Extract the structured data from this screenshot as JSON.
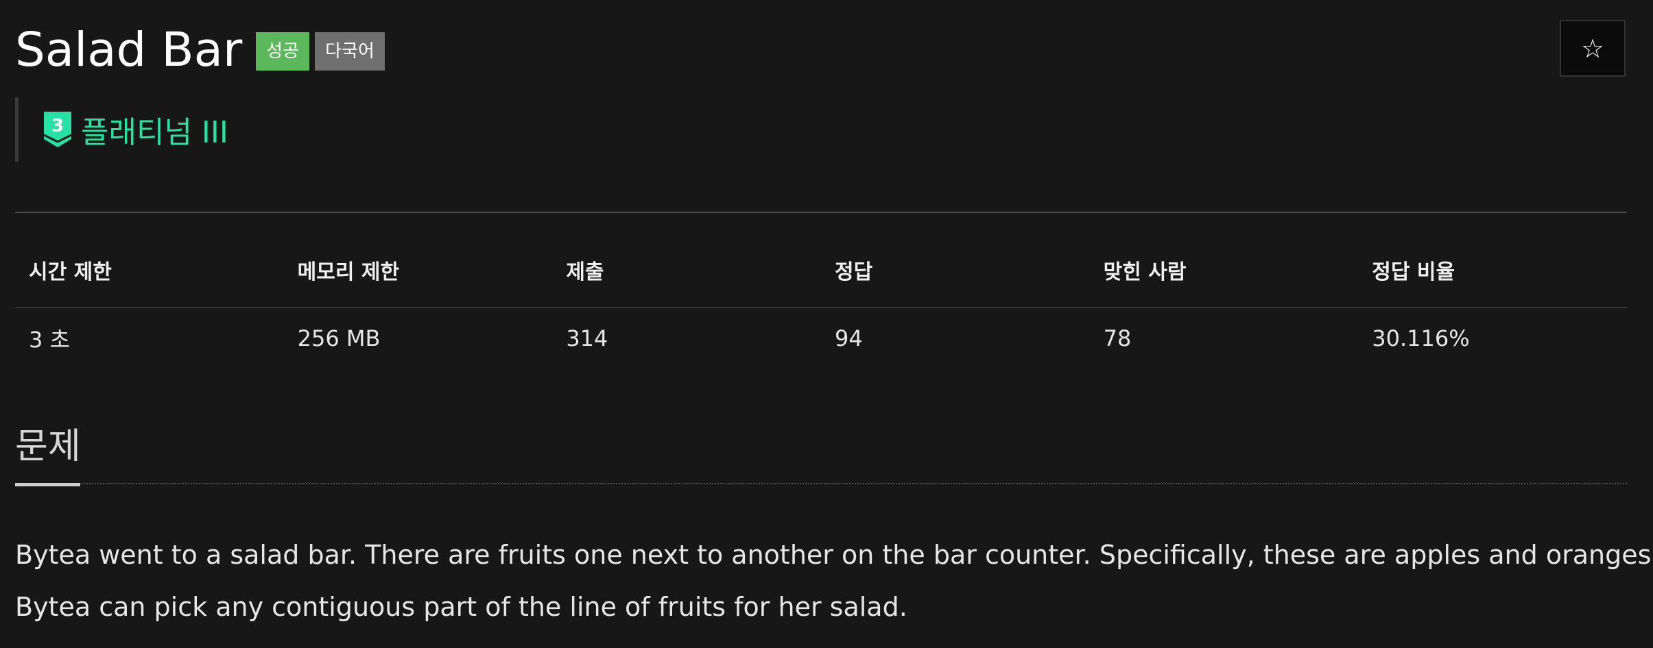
{
  "header": {
    "title": "Salad Bar",
    "badges": [
      "성공",
      "다국어"
    ],
    "star_glyph": "☆"
  },
  "tier": {
    "level": "3",
    "label": "플래티넘 III",
    "color": "#27e2a4"
  },
  "stats": {
    "headers": [
      "시간 제한",
      "메모리 제한",
      "제출",
      "정답",
      "맞힌 사람",
      "정답 비율"
    ],
    "values": [
      "3 초",
      "256 MB",
      "314",
      "94",
      "78",
      "30.116%"
    ]
  },
  "section": {
    "title": "문제"
  },
  "problem": {
    "lines": [
      "Bytea went to a salad bar. There are  fruits one next to another on the bar counter. Specifically, these are apples and oranges.",
      "Bytea can pick any contiguous part of the line of fruits for her salad."
    ]
  },
  "colors": {
    "background": "#171717",
    "success_badge": "#5cb85c",
    "multilang_badge": "#6f6f6f"
  }
}
